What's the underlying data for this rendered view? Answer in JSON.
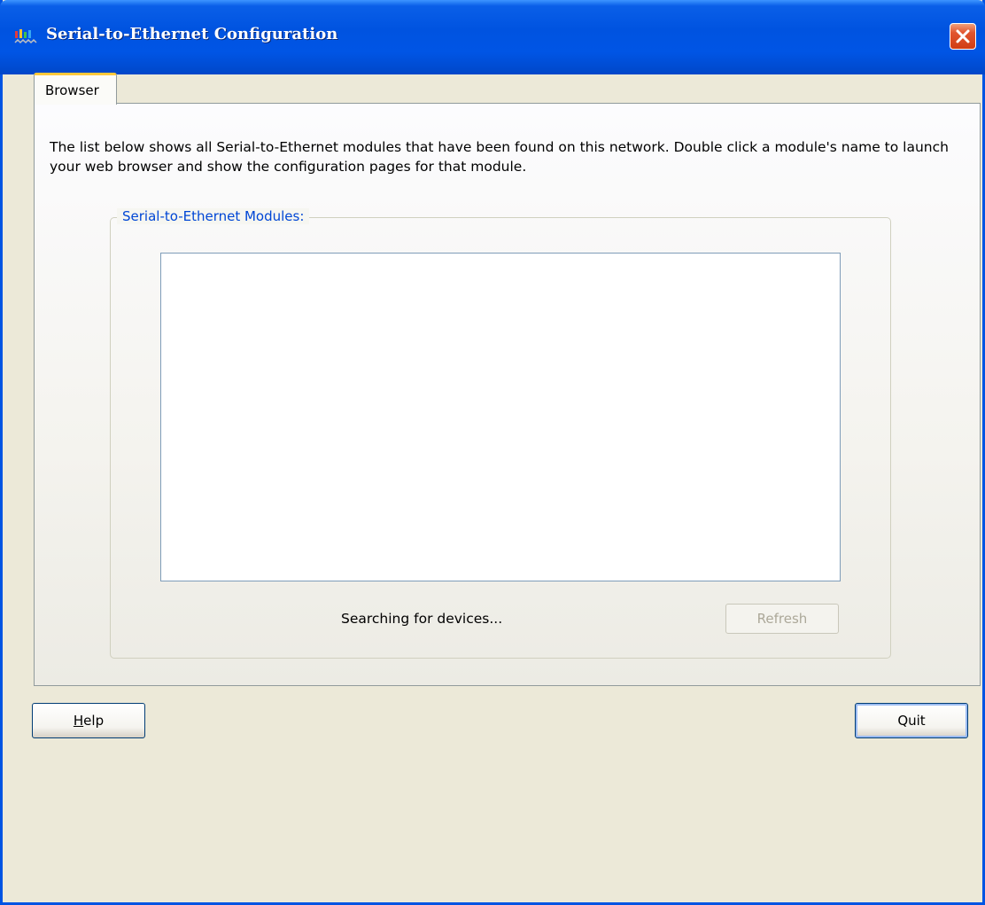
{
  "window": {
    "title": "Serial-to-Ethernet Configuration",
    "icon": "app-icon",
    "close_icon": "close-icon"
  },
  "tabs": [
    {
      "label": "Browser",
      "active": true
    }
  ],
  "browser_tab": {
    "description": "The list below shows all Serial-to-Ethernet modules that have been found on this network. Double click a module's name to launch your web browser and show the configuration pages for that module.",
    "group_label": "Serial-to-Ethernet Modules:",
    "modules": [],
    "status": "Searching for devices...",
    "refresh_label": "Refresh",
    "refresh_enabled": false
  },
  "buttons": {
    "help_mnemonic": "H",
    "help_rest": "elp",
    "quit_label": "Quit"
  },
  "colors": {
    "titlebar": "#0054e3",
    "face": "#ece9d8",
    "group_label": "#0046d5",
    "tab_highlight": "#ffc83c",
    "close_button": "#e2552f"
  }
}
